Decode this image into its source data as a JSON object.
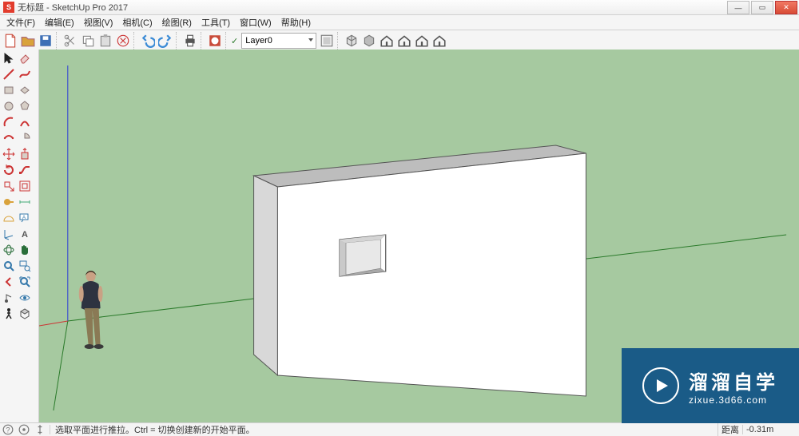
{
  "title": "无标题 - SketchUp Pro 2017",
  "menu": [
    "文件(F)",
    "编辑(E)",
    "视图(V)",
    "相机(C)",
    "绘图(R)",
    "工具(T)",
    "窗口(W)",
    "帮助(H)"
  ],
  "layer_combo": {
    "checkmark": "✓",
    "value": "Layer0"
  },
  "status": {
    "hint": "选取平面进行推拉。Ctrl = 切换创建新的开始平面。",
    "vcb_label": "距离",
    "vcb_value": "-0.31m"
  },
  "watermark": {
    "cn": "溜溜自学",
    "url": "zixue.3d66.com"
  },
  "win_controls": {
    "min": "—",
    "max": "▭",
    "close": "✕"
  },
  "std_toolbar": [
    {
      "name": "new-icon",
      "color": "#c94b3a",
      "glyph": "file"
    },
    {
      "name": "open-icon",
      "color": "#d9a23b",
      "glyph": "folder"
    },
    {
      "name": "save-icon",
      "color": "#3d6fb5",
      "glyph": "disk"
    },
    {
      "sep": true
    },
    {
      "name": "cut-icon",
      "color": "#888",
      "glyph": "scissors"
    },
    {
      "name": "copy-icon",
      "color": "#888",
      "glyph": "copy"
    },
    {
      "name": "paste-icon",
      "color": "#888",
      "glyph": "paste"
    },
    {
      "name": "delete-icon",
      "color": "#c33",
      "glyph": "x"
    },
    {
      "sep": true
    },
    {
      "name": "undo-icon",
      "color": "#3b8bd6",
      "glyph": "undo"
    },
    {
      "name": "redo-icon",
      "color": "#3b8bd6",
      "glyph": "redo"
    },
    {
      "sep": true
    },
    {
      "name": "print-icon",
      "color": "#555",
      "glyph": "printer"
    },
    {
      "sep": true
    },
    {
      "name": "model-info-icon",
      "color": "#c94b3a",
      "glyph": "info"
    }
  ],
  "std_toolbar_right": [
    {
      "name": "make-component-icon",
      "color": "#777",
      "glyph": "cube"
    },
    {
      "name": "paint-bucket-icon",
      "color": "#777",
      "glyph": "cube2"
    },
    {
      "name": "house1-icon",
      "color": "#555",
      "glyph": "house"
    },
    {
      "name": "house2-icon",
      "color": "#555",
      "glyph": "house"
    },
    {
      "name": "house3-icon",
      "color": "#555",
      "glyph": "house"
    },
    {
      "name": "house4-icon",
      "color": "#555",
      "glyph": "house"
    }
  ],
  "left_tools": [
    {
      "name": "select-icon",
      "glyph": "cursor",
      "c": "#222"
    },
    {
      "name": "eraser-icon",
      "glyph": "eraser",
      "c": "#d77"
    },
    {
      "name": "line-icon",
      "glyph": "line",
      "c": "#c33"
    },
    {
      "name": "freehand-icon",
      "glyph": "squig",
      "c": "#c33"
    },
    {
      "name": "rectangle-icon",
      "glyph": "rect",
      "c": "#a99"
    },
    {
      "name": "rotated-rect-icon",
      "glyph": "rrect",
      "c": "#a99"
    },
    {
      "name": "circle-icon",
      "glyph": "circle",
      "c": "#a99"
    },
    {
      "name": "polygon-icon",
      "glyph": "poly",
      "c": "#a99"
    },
    {
      "name": "arc-icon",
      "glyph": "arc",
      "c": "#c33"
    },
    {
      "name": "two-point-arc-icon",
      "glyph": "arc2",
      "c": "#c33"
    },
    {
      "name": "three-point-arc-icon",
      "glyph": "arc3",
      "c": "#c33"
    },
    {
      "name": "pie-icon",
      "glyph": "pie",
      "c": "#a99"
    },
    {
      "name": "move-icon",
      "glyph": "move",
      "c": "#c33"
    },
    {
      "name": "pushpull-icon",
      "glyph": "pushpull",
      "c": "#c33"
    },
    {
      "name": "rotate-icon",
      "glyph": "rotate",
      "c": "#c33"
    },
    {
      "name": "followme-icon",
      "glyph": "follow",
      "c": "#c33"
    },
    {
      "name": "scale-icon",
      "glyph": "scale",
      "c": "#c33"
    },
    {
      "name": "offset-icon",
      "glyph": "offset",
      "c": "#c33"
    },
    {
      "name": "tape-icon",
      "glyph": "tape",
      "c": "#d9a23b"
    },
    {
      "name": "dimension-icon",
      "glyph": "dim",
      "c": "#4a7"
    },
    {
      "name": "protractor-icon",
      "glyph": "prot",
      "c": "#d9a23b"
    },
    {
      "name": "text-icon",
      "glyph": "text",
      "c": "#37a"
    },
    {
      "name": "axes-icon",
      "glyph": "axes",
      "c": "#37a"
    },
    {
      "name": "3dtext-icon",
      "glyph": "3dA",
      "c": "#555"
    },
    {
      "name": "orbit-icon",
      "glyph": "orbit",
      "c": "#2a6e3a"
    },
    {
      "name": "pan-icon",
      "glyph": "hand",
      "c": "#2a6e3a"
    },
    {
      "name": "zoom-icon",
      "glyph": "zoom",
      "c": "#37a"
    },
    {
      "name": "zoom-window-icon",
      "glyph": "zoomw",
      "c": "#37a"
    },
    {
      "name": "previous-icon",
      "glyph": "prev",
      "c": "#c33"
    },
    {
      "name": "zoom-extents-icon",
      "glyph": "zoome",
      "c": "#37a"
    },
    {
      "name": "position-camera-icon",
      "glyph": "cam",
      "c": "#555"
    },
    {
      "name": "lookaround-icon",
      "glyph": "eye",
      "c": "#37a"
    },
    {
      "name": "walk-icon",
      "glyph": "walk",
      "c": "#222"
    },
    {
      "name": "section-icon",
      "glyph": "sect",
      "c": "#555"
    }
  ]
}
